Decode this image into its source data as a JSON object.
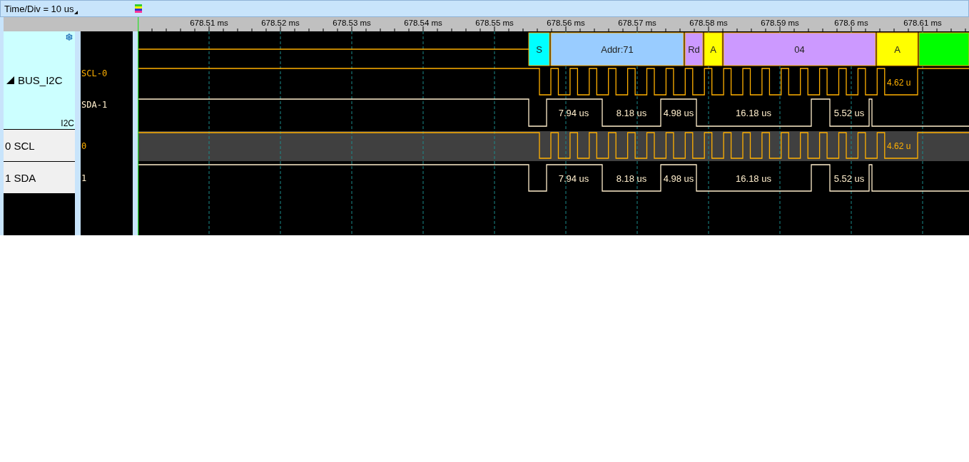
{
  "toolbar": {
    "time_div": "Time/Div = 10 us"
  },
  "ruler": {
    "ticks": [
      "678.51 ms",
      "678.52 ms",
      "678.53 ms",
      "678.54 ms",
      "678.55 ms",
      "678.56 ms",
      "678.57 ms",
      "678.58 ms",
      "678.59 ms",
      "678.6 ms",
      "678.61 ms"
    ]
  },
  "bus": {
    "name": "BUS_I2C",
    "expanded": true,
    "protocol": "I2C",
    "segments": [
      {
        "label": "S",
        "color": "#00ffff"
      },
      {
        "label": "Addr:71",
        "color": "#99ccff"
      },
      {
        "label": "Rd",
        "color": "#cc99ff"
      },
      {
        "label": "A",
        "color": "#ffff00"
      },
      {
        "label": "04",
        "color": "#cc99ff"
      },
      {
        "label": "A",
        "color": "#ffff00"
      },
      {
        "color": "#00ff00"
      }
    ],
    "signals": [
      {
        "kind": "clock",
        "label": "SCL-0",
        "color": "#ffb000",
        "measurements": [
          "4.62 u"
        ]
      },
      {
        "kind": "data",
        "label": "SDA-1",
        "color": "#ffeecc",
        "measurements": [
          "7.94 us",
          "8.18 us",
          "4.98 us",
          "16.18 us",
          "5.52 us"
        ]
      }
    ]
  },
  "channels": [
    {
      "kind": "clock",
      "name": "0 SCL",
      "value": "0",
      "color": "#ffb000",
      "selected": true,
      "measurements": [
        "4.62 u"
      ]
    },
    {
      "kind": "data",
      "name": "1 SDA",
      "value": "1",
      "color": "#ffeecc",
      "selected": false,
      "measurements": [
        "7.94 us",
        "8.18 us",
        "4.98 us",
        "16.18 us",
        "5.52 us"
      ]
    }
  ]
}
